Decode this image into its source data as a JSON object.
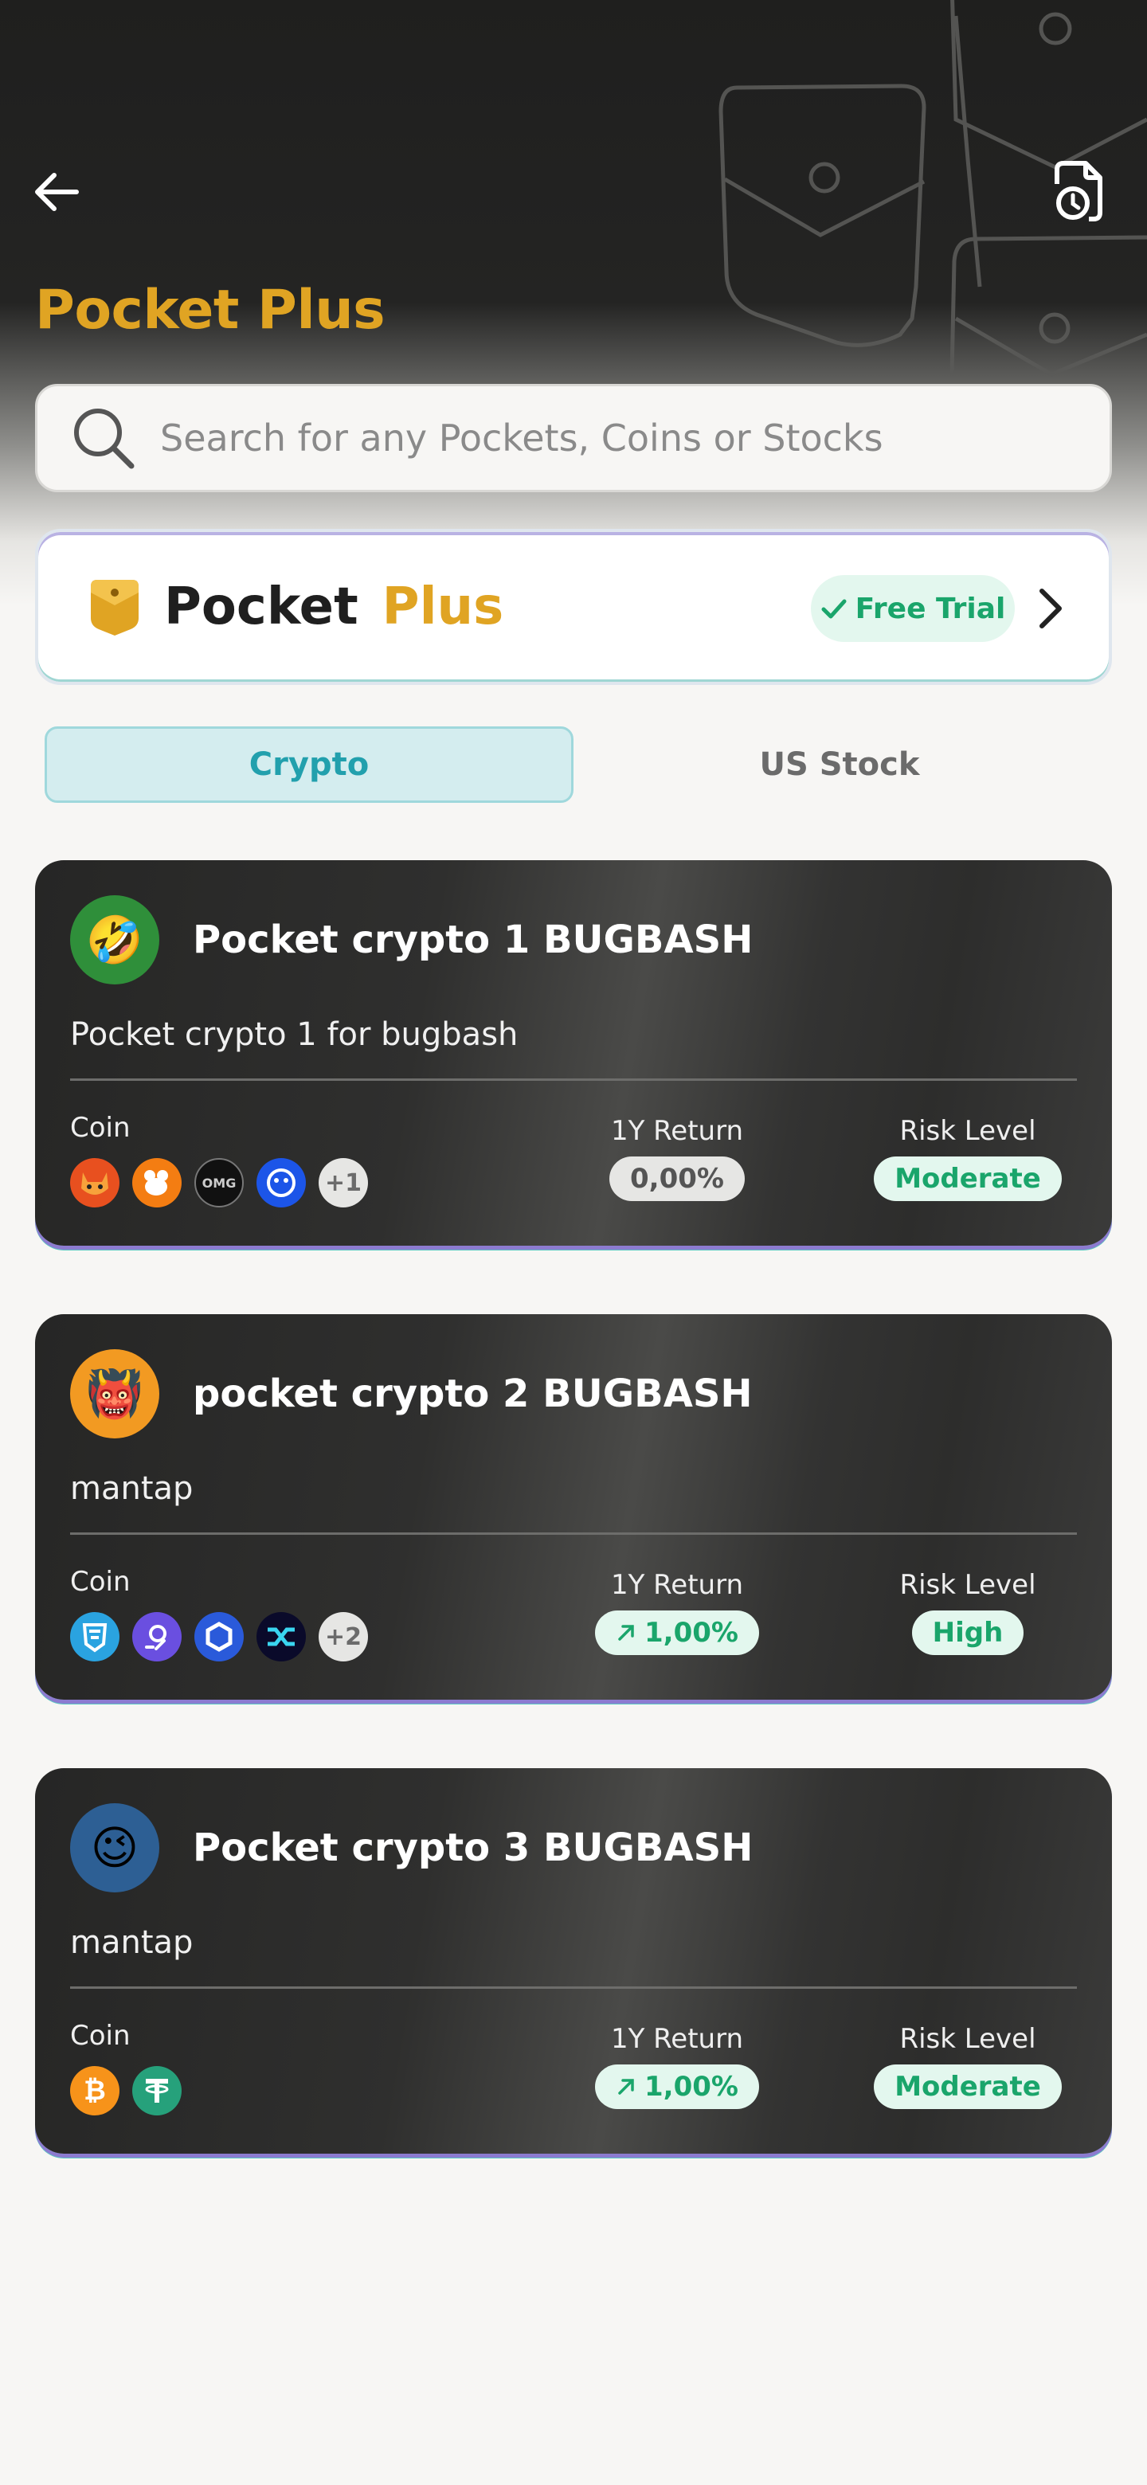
{
  "header": {
    "title": "Pocket Plus",
    "back_icon": "arrow-left-icon",
    "history_icon": "document-history-icon"
  },
  "search": {
    "placeholder": "Search for any Pockets, Coins or Stocks",
    "value": ""
  },
  "banner": {
    "word1": "Pocket",
    "word2": "Plus",
    "badge": "Free Trial"
  },
  "tabs": [
    {
      "label": "Crypto",
      "active": true
    },
    {
      "label": "US Stock",
      "active": false
    }
  ],
  "labels": {
    "coin": "Coin",
    "return": "1Y Return",
    "risk": "Risk Level"
  },
  "pockets": [
    {
      "emoji": "🤣",
      "title": "Pocket crypto 1 BUGBASH",
      "description": "Pocket crypto 1 for bugbash",
      "coins": [
        "shiba-coin",
        "mouse-coin",
        "omg-coin",
        "ape-coin"
      ],
      "more": "+1",
      "return": "0,00%",
      "return_trend": "neutral",
      "risk": "Moderate"
    },
    {
      "emoji": "👹",
      "title": "pocket crypto 2 BUGBASH",
      "description": "mantap",
      "coins": [
        "shield-coin",
        "graph-coin",
        "chainlink-coin",
        "synthetix-coin"
      ],
      "more": "+2",
      "return": "1,00%",
      "return_trend": "up",
      "risk": "High"
    },
    {
      "emoji": "😉",
      "title": "Pocket crypto 3 BUGBASH",
      "description": "mantap",
      "coins": [
        "bitcoin-coin",
        "tether-coin"
      ],
      "more": "",
      "return": "1,00%",
      "return_trend": "up",
      "risk": "Moderate"
    }
  ],
  "colors": {
    "accent": "#e0a423",
    "positive": "#1aa56b",
    "tab_active": "#22a0ad"
  }
}
